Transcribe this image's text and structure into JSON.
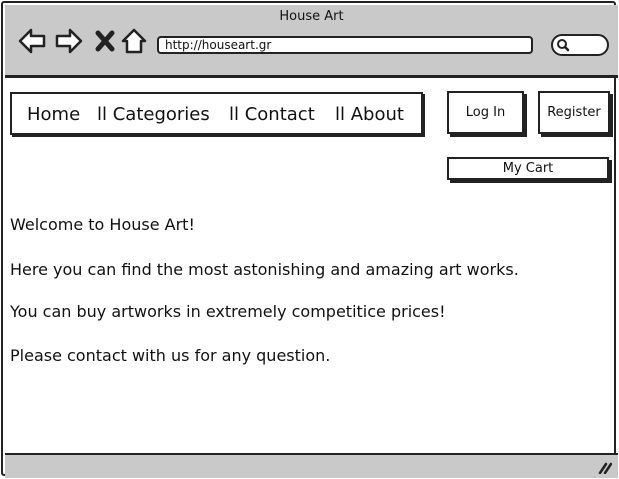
{
  "window": {
    "title": "House Art"
  },
  "browser": {
    "url": "http://houseart.gr",
    "icons": [
      "back-arrow-icon",
      "forward-arrow-icon",
      "stop-icon",
      "home-icon",
      "search-icon"
    ]
  },
  "nav": {
    "home": "Home",
    "categories": "ll Categories",
    "contact": "ll Contact",
    "about": "ll About"
  },
  "actions": {
    "login": "Log In",
    "register": "Register",
    "cart": "My Cart"
  },
  "content": {
    "welcome": "Welcome to House Art!",
    "line1": "Here you can find the most astonishing and amazing art works.",
    "line2": "You can buy artworks in extremely competitice prices!",
    "line3": "Please contact with us for any question."
  }
}
